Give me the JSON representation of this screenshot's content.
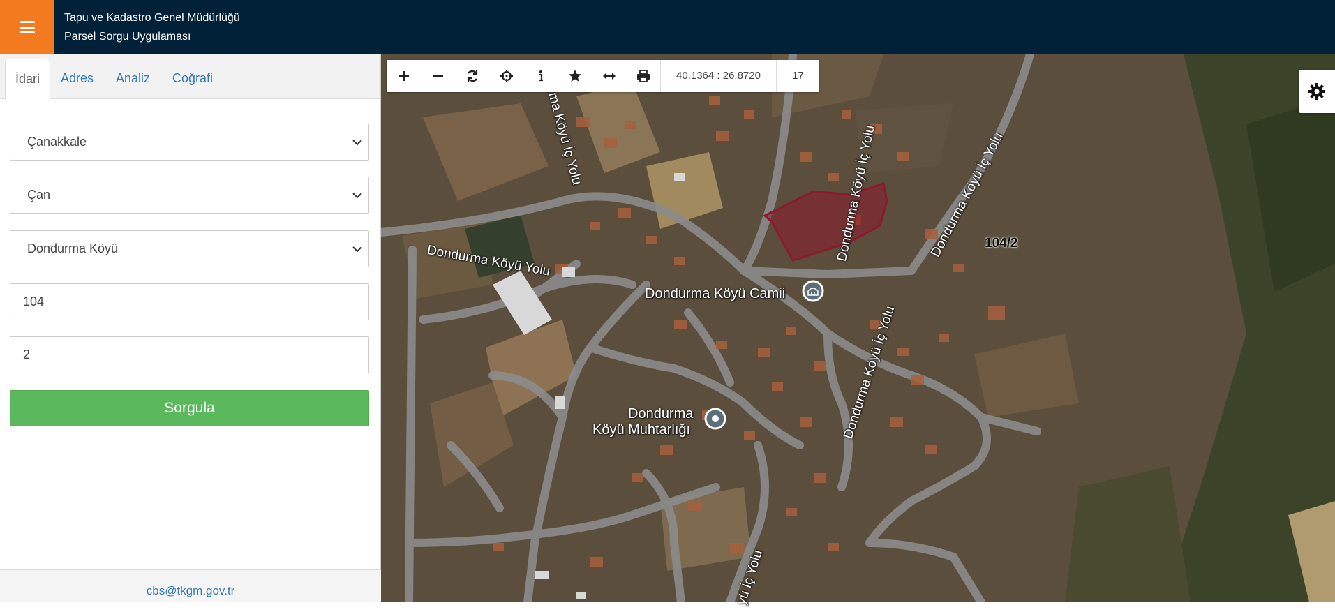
{
  "header": {
    "title_line1": "Tapu ve Kadastro Genel Müdürlüğü",
    "title_line2": "Parsel Sorgu Uygulaması",
    "accent_color": "#f47a20",
    "bg_color": "#002138"
  },
  "tabs": [
    {
      "label": "İdari",
      "active": true
    },
    {
      "label": "Adres",
      "active": false
    },
    {
      "label": "Analiz",
      "active": false
    },
    {
      "label": "Coğrafi",
      "active": false
    }
  ],
  "form": {
    "il": "Çanakkale",
    "ilce": "Çan",
    "mahalle": "Dondurma Köyü",
    "ada": "104",
    "parsel": "2",
    "submit_label": "Sorgula",
    "submit_color": "#5cb85c"
  },
  "footer": {
    "email": "cbs@tkgm.gov.tr"
  },
  "map": {
    "tools": [
      "plus-icon",
      "minus-icon",
      "refresh-icon",
      "locate-icon",
      "info-icon",
      "star-icon",
      "measure-icon",
      "print-icon"
    ],
    "coordinates": "40.1364 : 26.8720",
    "zoom_level": "17",
    "parcel_label": "104/2",
    "parcel_color": "#8b1a2b",
    "labels": {
      "road1": "Dondurma Köyü Yolu",
      "road2": "rma Köyü İç Yolu",
      "road3": "Dondurma Köyü İç Yolu",
      "road4": "Dondurma Köyü İç Yolu",
      "road5": "Dondurma Köyü İç Yolu",
      "road6": "yü İç Yolu",
      "poi_camii": "Dondurma Köyü Camii",
      "poi_muhtar_1": "Dondurma",
      "poi_muhtar_2": "Köyü Muhtarlığı"
    }
  }
}
